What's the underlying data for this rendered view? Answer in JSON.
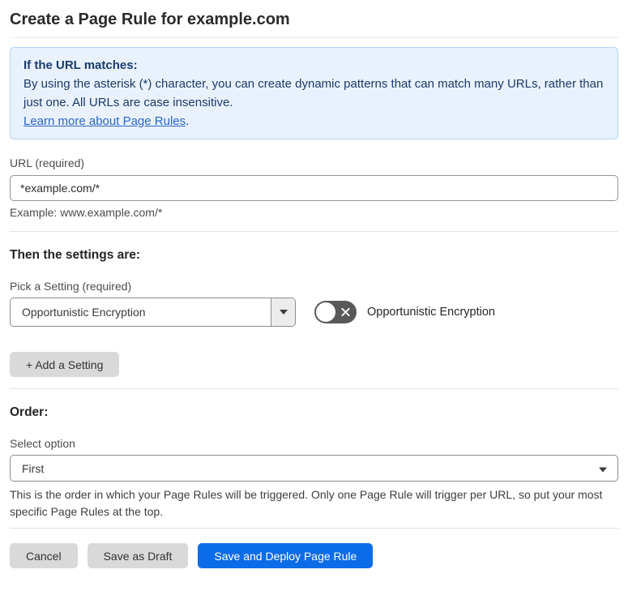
{
  "page": {
    "title": "Create a Page Rule for example.com"
  },
  "info_box": {
    "heading": "If the URL matches:",
    "body": "By using the asterisk (*) character, you can create dynamic patterns that can match many URLs, rather than just one. All URLs are case insensitive.",
    "link": "Learn more about Page Rules",
    "link_suffix": "."
  },
  "url_field": {
    "label": "URL (required)",
    "value": "*example.com/*",
    "example": "Example: www.example.com/*"
  },
  "settings_section": {
    "heading": "Then the settings are:",
    "picker_label": "Pick a Setting (required)",
    "selected_setting": "Opportunistic Encryption",
    "toggle_state": "off",
    "toggle_label": "Opportunistic Encryption",
    "add_button_label": "+ Add a Setting"
  },
  "order_section": {
    "heading": "Order:",
    "label": "Select option",
    "selected_option": "First",
    "description": "This is the order in which your Page Rules will be triggered. Only one Page Rule will trigger per URL, so put your most specific Page Rules at the top."
  },
  "actions": {
    "cancel_label": "Cancel",
    "save_draft_label": "Save as Draft",
    "save_deploy_label": "Save and Deploy Page Rule"
  },
  "colors": {
    "primary_blue": "#0b6ce8",
    "info_box_bg": "#e9f2fc",
    "info_box_border": "#b3d4f2",
    "info_box_text": "#1b3a6b",
    "link_blue": "#2c66c4",
    "gray_button_bg": "#d9d9d9",
    "toggle_off_bg": "#595959"
  }
}
